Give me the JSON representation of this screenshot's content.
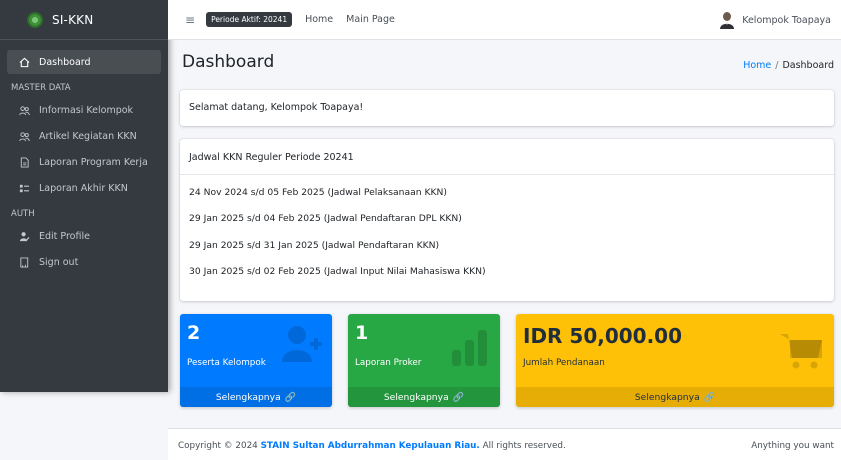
{
  "brand": {
    "name": "SI-KKN"
  },
  "sidebar": {
    "dashboard": "Dashboard",
    "master_header": "MASTER DATA",
    "master_items": [
      {
        "label": "Informasi Kelompok"
      },
      {
        "label": "Artikel Kegiatan KKN"
      },
      {
        "label": "Laporan Program Kerja"
      },
      {
        "label": "Laporan Akhir KKN"
      }
    ],
    "auth_header": "AUTH",
    "auth_items": [
      {
        "label": "Edit Profile"
      },
      {
        "label": "Sign out"
      }
    ]
  },
  "topbar": {
    "periode_badge": "Periode Aktif: 20241",
    "links": [
      "Home",
      "Main Page"
    ],
    "user_name": "Kelompok Toapaya"
  },
  "page": {
    "title": "Dashboard",
    "breadcrumb_home": "Home",
    "breadcrumb_sep": "/",
    "breadcrumb_current": "Dashboard"
  },
  "welcome": "Selamat datang, Kelompok Toapaya!",
  "jadwal": {
    "title": "Jadwal KKN Reguler Periode 20241",
    "items": [
      "24 Nov 2024 s/d 05 Feb 2025 (Jadwal Pelaksanaan KKN)",
      "29 Jan 2025 s/d 04 Feb 2025 (Jadwal Pendaftaran DPL KKN)",
      "29 Jan 2025 s/d 31 Jan 2025 (Jadwal Pendaftaran KKN)",
      "30 Jan 2025 s/d 02 Feb 2025 (Jadwal Input Nilai Mahasiswa KKN)"
    ]
  },
  "boxes": [
    {
      "value": "2",
      "label": "Peserta Kelompok",
      "footer": "Selengkapnya",
      "icon": "user-plus-icon",
      "color": "#007bff"
    },
    {
      "value": "1",
      "label": "Laporan Proker",
      "footer": "Selengkapnya",
      "icon": "bar-chart-icon",
      "color": "#28a745"
    },
    {
      "value": "IDR 50,000.00",
      "label": "Jumlah Pendanaan",
      "footer": "Selengkapnya",
      "icon": "shopping-cart-icon",
      "color": "#ffc107"
    }
  ],
  "footer": {
    "copyright": "Copyright © 2024",
    "org": "STAIN Sultan Abdurrahman Kepulauan Riau.",
    "rights": "All rights reserved.",
    "right_text": "Anything you want"
  }
}
